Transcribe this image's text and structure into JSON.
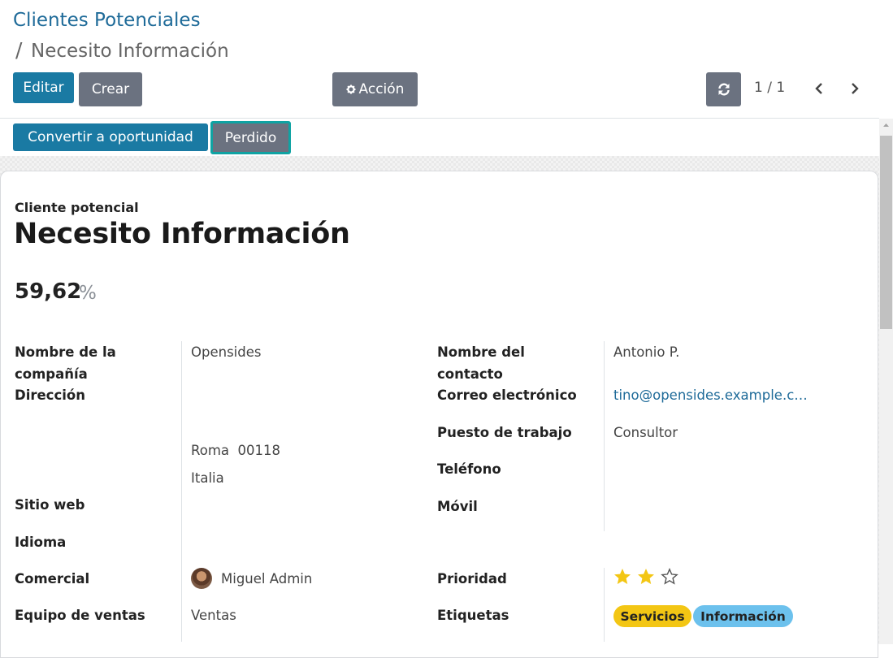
{
  "breadcrumb": {
    "parent": "Clientes Potenciales",
    "separator": "/",
    "current": "Necesito Información"
  },
  "toolbar": {
    "edit_label": "Editar",
    "create_label": "Crear",
    "action_label": "Acción"
  },
  "pager": {
    "value": "1 / 1"
  },
  "statusbar": {
    "convert_label": "Convertir a oportunidad",
    "lost_label": "Perdido"
  },
  "form": {
    "record_type": "Cliente potencial",
    "title": "Necesito Información",
    "probability": "59,62",
    "probability_unit": "%",
    "left": {
      "company_label_line1": "Nombre de la",
      "company_label_line2": "compañía",
      "company_value": "Opensides",
      "address_label": "Dirección",
      "address_city_zip": "Roma  00118",
      "address_country": "Italia",
      "website_label": "Sitio web",
      "language_label": "Idioma",
      "salesperson_label": "Comercial",
      "salesperson_value": "Miguel Admin",
      "team_label": "Equipo de ventas",
      "team_value": "Ventas"
    },
    "right": {
      "contact_label_line1": "Nombre del",
      "contact_label_line2": "contacto",
      "contact_value": "Antonio P.",
      "email_label": "Correo electrónico",
      "email_value": "tino@opensides.example.c…",
      "job_label": "Puesto de trabajo",
      "job_value": "Consultor",
      "phone_label": "Teléfono",
      "mobile_label": "Móvil",
      "priority_label": "Prioridad",
      "priority_stars_filled": 2,
      "priority_stars_total": 3,
      "tags_label": "Etiquetas",
      "tags": [
        "Servicios",
        "Información"
      ]
    }
  },
  "colors": {
    "primary": "#1a7aa3",
    "secondary": "#6b7280",
    "link": "#1f6b99",
    "star": "#f3c614",
    "tag_yellow": "#f3c614",
    "tag_blue": "#6cc1ed",
    "focus_outline": "#0fa3a3"
  },
  "icons": {
    "action": "gear-icon",
    "refresh": "refresh-icon",
    "prev": "chevron-left-icon",
    "next": "chevron-right-icon",
    "star_filled": "star-filled-icon",
    "star_empty": "star-empty-icon"
  }
}
